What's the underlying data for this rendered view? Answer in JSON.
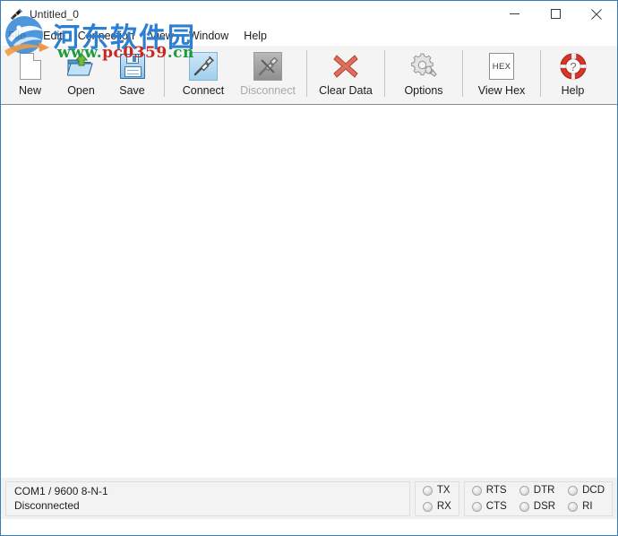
{
  "window": {
    "title": "Untitled_0",
    "app_icon": "serial-plug-icon",
    "controls": [
      {
        "name": "minimize",
        "glyph": "minimize-icon"
      },
      {
        "name": "maximize",
        "glyph": "maximize-icon"
      },
      {
        "name": "close",
        "glyph": "close-icon"
      }
    ],
    "border_color": "#3a7cb8"
  },
  "menubar": {
    "items": [
      {
        "label": "File"
      },
      {
        "label": "Edit"
      },
      {
        "label": "Connection"
      },
      {
        "label": "View"
      },
      {
        "label": "Window"
      },
      {
        "label": "Help"
      }
    ]
  },
  "toolbar": {
    "background": "#f4f4f4",
    "groups": [
      {
        "buttons": [
          {
            "label": "New",
            "icon": "new-document-icon",
            "enabled": true
          },
          {
            "label": "Open",
            "icon": "open-folder-icon",
            "enabled": true
          },
          {
            "label": "Save",
            "icon": "save-floppy-icon",
            "enabled": true
          }
        ]
      },
      {
        "buttons": [
          {
            "label": "Connect",
            "icon": "connect-plug-icon",
            "enabled": true
          },
          {
            "label": "Disconnect",
            "icon": "disconnect-plug-icon",
            "enabled": false
          }
        ]
      },
      {
        "buttons": [
          {
            "label": "Clear Data",
            "icon": "red-x-icon",
            "enabled": true
          }
        ]
      },
      {
        "buttons": [
          {
            "label": "Options",
            "icon": "gear-wrench-icon",
            "enabled": true
          }
        ]
      },
      {
        "buttons": [
          {
            "label": "View Hex",
            "icon": "hex-box-icon",
            "enabled": true
          }
        ]
      },
      {
        "buttons": [
          {
            "label": "Help",
            "icon": "life-ring-help-icon",
            "enabled": true
          }
        ]
      }
    ]
  },
  "content": {
    "text": ""
  },
  "statusbar": {
    "connection_info": "COM1 / 9600 8-N-1",
    "connection_state": "Disconnected",
    "led_groups": [
      {
        "name": "data-leds",
        "columns": [
          {
            "top": "TX",
            "bottom": "RX"
          }
        ]
      },
      {
        "name": "modem-leds",
        "columns": [
          {
            "top": "RTS",
            "bottom": "CTS"
          },
          {
            "top": "DTR",
            "bottom": "DSR"
          },
          {
            "top": "DCD",
            "bottom": "RI"
          }
        ]
      }
    ],
    "led_state": "off",
    "led_off_color": "#e2e2e2"
  },
  "watermark": {
    "site_name": "河东软件园",
    "url_prefix": "www.",
    "url_mid": "pc0359",
    "url_suffix": ".cn",
    "name_color": "#2d7fd1",
    "url_color": "#1f9a3d",
    "url_accent_color": "#c9261f"
  }
}
